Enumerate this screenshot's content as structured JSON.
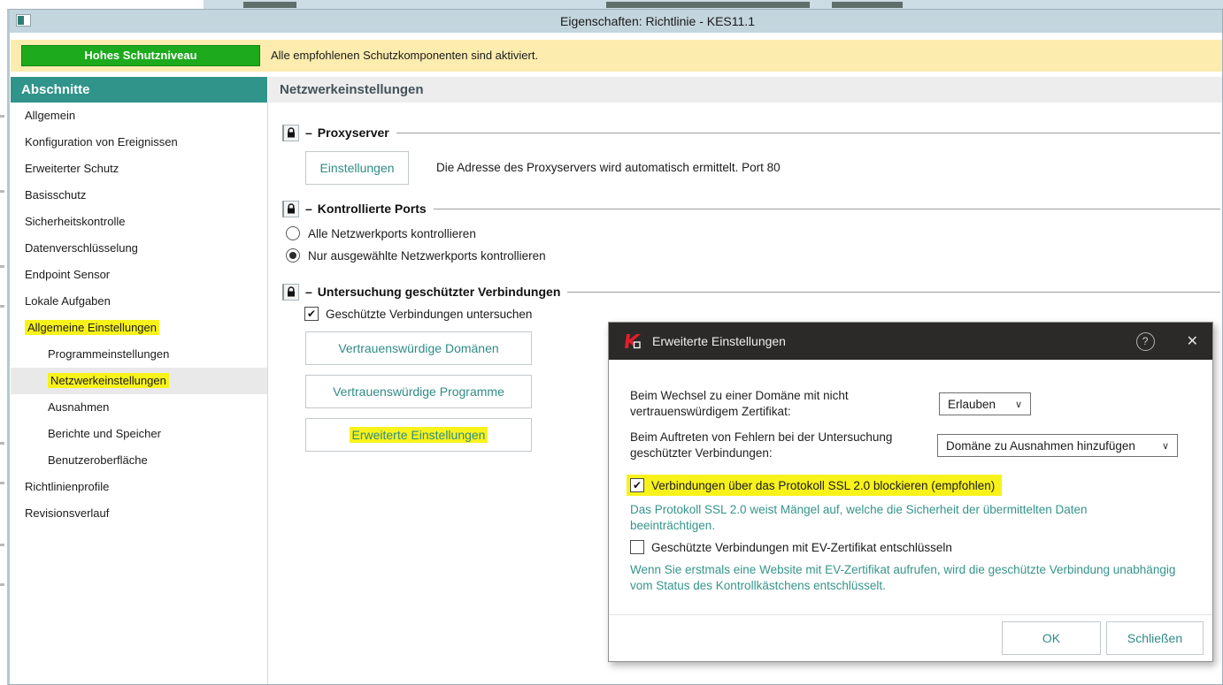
{
  "window": {
    "title": "Eigenschaften: Richtlinie - KES11.1"
  },
  "banner": {
    "level_button": "Hohes Schutzniveau",
    "message": "Alle empfohlenen Schutzkomponenten sind aktiviert."
  },
  "sidebar": {
    "header": "Abschnitte",
    "items": [
      {
        "label": "Allgemein",
        "indented": false,
        "highlighted": false,
        "selected": false
      },
      {
        "label": "Konfiguration von Ereignissen",
        "indented": false,
        "highlighted": false,
        "selected": false
      },
      {
        "label": "Erweiterter Schutz",
        "indented": false,
        "highlighted": false,
        "selected": false
      },
      {
        "label": "Basisschutz",
        "indented": false,
        "highlighted": false,
        "selected": false
      },
      {
        "label": "Sicherheitskontrolle",
        "indented": false,
        "highlighted": false,
        "selected": false
      },
      {
        "label": "Datenverschlüsselung",
        "indented": false,
        "highlighted": false,
        "selected": false
      },
      {
        "label": "Endpoint Sensor",
        "indented": false,
        "highlighted": false,
        "selected": false
      },
      {
        "label": "Lokale Aufgaben",
        "indented": false,
        "highlighted": false,
        "selected": false
      },
      {
        "label": "Allgemeine Einstellungen",
        "indented": false,
        "highlighted": true,
        "selected": false
      },
      {
        "label": "Programmeinstellungen",
        "indented": true,
        "highlighted": false,
        "selected": false
      },
      {
        "label": "Netzwerkeinstellungen",
        "indented": true,
        "highlighted": true,
        "selected": true
      },
      {
        "label": "Ausnahmen",
        "indented": true,
        "highlighted": false,
        "selected": false
      },
      {
        "label": "Berichte und Speicher",
        "indented": true,
        "highlighted": false,
        "selected": false
      },
      {
        "label": "Benutzeroberfläche",
        "indented": true,
        "highlighted": false,
        "selected": false
      },
      {
        "label": "Richtlinienprofile",
        "indented": false,
        "highlighted": false,
        "selected": false
      },
      {
        "label": "Revisionsverlauf",
        "indented": false,
        "highlighted": false,
        "selected": false
      }
    ]
  },
  "main": {
    "title": "Netzwerkeinstellungen",
    "proxy_section": {
      "title": "Proxyserver",
      "settings_button": "Einstellungen",
      "description": "Die Adresse des Proxyservers wird automatisch ermittelt. Port 80"
    },
    "ports_section": {
      "title": "Kontrollierte Ports",
      "radio_all": {
        "label": "Alle Netzwerkports kontrollieren",
        "checked": false
      },
      "radio_selected": {
        "label": "Nur ausgewählte Netzwerkports kontrollieren",
        "checked": true
      }
    },
    "tls_section": {
      "title": "Untersuchung geschützter Verbindungen",
      "inspect_checkbox": {
        "label": "Geschützte Verbindungen untersuchen",
        "checked": true
      },
      "trusted_domains_button": "Vertrauenswürdige Domänen",
      "trusted_programs_button": "Vertrauenswürdige Programme",
      "advanced_settings_button": "Erweiterte Einstellungen"
    }
  },
  "dialog": {
    "title": "Erweiterte Einstellungen",
    "untrusted_cert_row": {
      "label": "Beim Wechsel zu einer Domäne mit nicht vertrauenswürdigem Zertifikat:",
      "value": "Erlauben"
    },
    "scan_errors_row": {
      "label": "Beim Auftreten von Fehlern bei der Untersuchung geschützter Verbindungen:",
      "value": "Domäne zu Ausnahmen hinzufügen"
    },
    "ssl2_checkbox": {
      "label": "Verbindungen über das Protokoll SSL 2.0 blockieren (empfohlen)",
      "checked": true
    },
    "ssl2_note": "Das Protokoll SSL 2.0 weist Mängel auf, welche die Sicherheit der übermittelten Daten beeinträchtigen.",
    "ev_checkbox": {
      "label": "Geschützte Verbindungen mit EV-Zertifikat entschlüsseln",
      "checked": false
    },
    "ev_note": "Wenn Sie erstmals eine Website mit EV-Zertifikat aufrufen, wird die geschützte Verbindung unabhängig vom Status des Kontrollkästchens entschlüsselt.",
    "ok_button": "OK",
    "close_button": "Schließen"
  },
  "ui": {
    "collapse_dash": "–",
    "dropdown_chevron": "∨",
    "check_glyph": "✔",
    "help_glyph": "?",
    "close_glyph": "✕"
  },
  "colors": {
    "accent_teal": "#2f8c85",
    "highlight_yellow": "#f8f21b",
    "banner_yellow": "#fcecae",
    "level_green": "#1daa1d",
    "section_header_teal": "#30948a",
    "dialog_titlebar": "#2b2a28",
    "note_teal": "#35958b"
  }
}
